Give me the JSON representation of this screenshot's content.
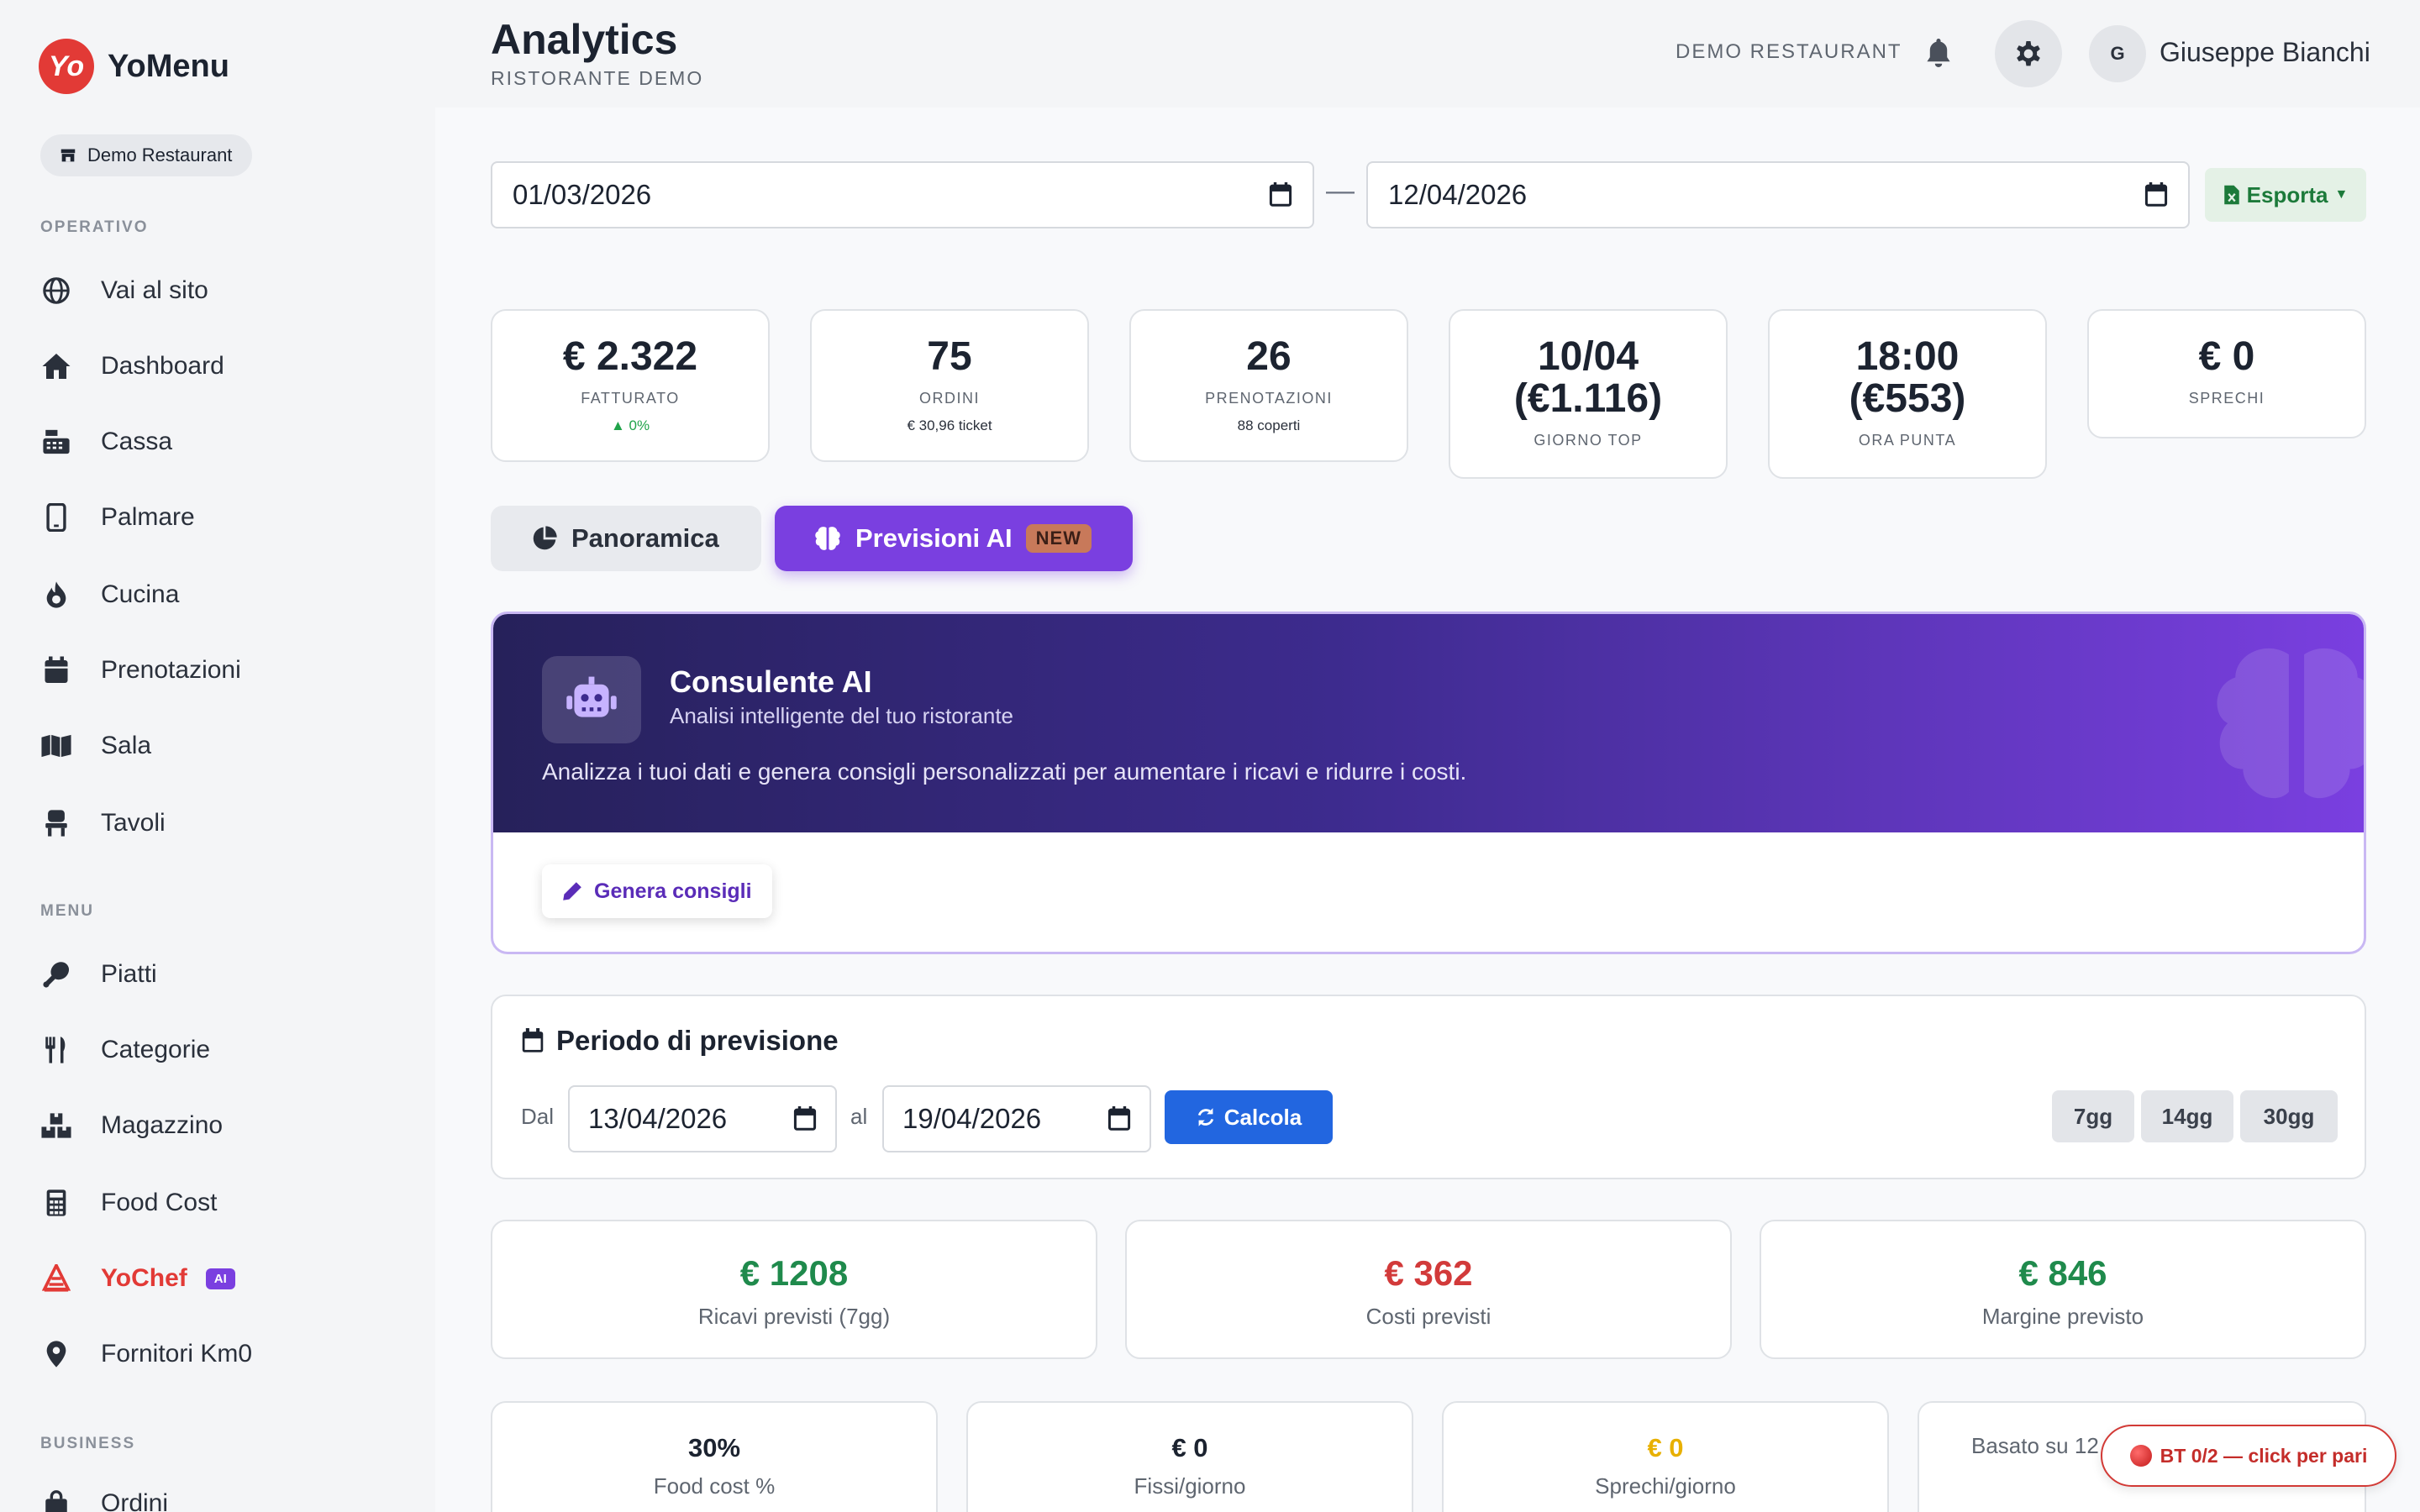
{
  "brand": {
    "logo_text": "Yo",
    "name": "YoMenu"
  },
  "restaurant_pill": "Demo Restaurant",
  "sidebar": {
    "sections": {
      "operativo": "OPERATIVO",
      "menu": "MENU",
      "business": "BUSINESS"
    },
    "items": [
      {
        "label": "Vai al sito",
        "icon": "globe-icon"
      },
      {
        "label": "Dashboard",
        "icon": "home-icon"
      },
      {
        "label": "Cassa",
        "icon": "cash-register-icon"
      },
      {
        "label": "Palmare",
        "icon": "mobile-icon"
      },
      {
        "label": "Cucina",
        "icon": "fire-icon"
      },
      {
        "label": "Prenotazioni",
        "icon": "calendar-icon"
      },
      {
        "label": "Sala",
        "icon": "map-icon"
      },
      {
        "label": "Tavoli",
        "icon": "chair-icon"
      },
      {
        "label": "Piatti",
        "icon": "drumstick-icon"
      },
      {
        "label": "Categorie",
        "icon": "utensils-icon"
      },
      {
        "label": "Magazzino",
        "icon": "boxes-icon"
      },
      {
        "label": "Food Cost",
        "icon": "calculator-icon"
      },
      {
        "label": "YoChef",
        "icon": "chef-icon",
        "badge": "AI"
      },
      {
        "label": "Fornitori Km0",
        "icon": "location-pin-icon"
      },
      {
        "label": "Ordini",
        "icon": "bag-icon"
      }
    ]
  },
  "header": {
    "title": "Analytics",
    "subtitle": "RISTORANTE DEMO",
    "restaurant": "DEMO RESTAURANT",
    "avatar_initial": "G",
    "user_name": "Giuseppe Bianchi"
  },
  "date_range": {
    "from": "01/03/2026",
    "separator": "—",
    "to": "12/04/2026"
  },
  "export_label": "Esporta",
  "kpis": [
    {
      "value": "€ 2.322",
      "label": "FATTURATO",
      "sub": "▲ 0%"
    },
    {
      "value": "75",
      "label": "ORDINI",
      "sub": "€ 30,96 ticket"
    },
    {
      "value": "26",
      "label": "PRENOTAZIONI",
      "sub": "88 coperti"
    },
    {
      "value_line1": "10/04",
      "value_line2": "(€1.116)",
      "label": "GIORNO TOP"
    },
    {
      "value_line1": "18:00",
      "value_line2": "(€553)",
      "label": "ORA PUNTA"
    },
    {
      "value": "€ 0",
      "label": "SPRECHI"
    }
  ],
  "tabs": {
    "overview": "Panoramica",
    "ai": "Previsioni AI",
    "ai_badge": "NEW"
  },
  "ai_card": {
    "title": "Consulente AI",
    "subtitle": "Analisi intelligente del tuo ristorante",
    "description": "Analizza i tuoi dati e genera consigli personalizzati per aumentare i ricavi e ridurre i costi.",
    "button": "Genera consigli"
  },
  "forecast_period": {
    "title": "Periodo di previsione",
    "from_label": "Dal",
    "from": "13/04/2026",
    "to_label": "al",
    "to": "19/04/2026",
    "calc_button": "Calcola",
    "ranges": [
      "7gg",
      "14gg",
      "30gg"
    ]
  },
  "forecast_totals": [
    {
      "value": "€ 1208",
      "label": "Ricavi previsti (7gg)",
      "color": "#1f8a4c"
    },
    {
      "value": "€ 362",
      "label": "Costi previsti",
      "color": "#d23a3a"
    },
    {
      "value": "€ 846",
      "label": "Margine previsto",
      "color": "#1f8a4c"
    }
  ],
  "small_stats": [
    {
      "value": "30%",
      "label": "Food cost %",
      "color": "#1c2330"
    },
    {
      "value": "€ 0",
      "label": "Fissi/giorno",
      "color": "#1c2330"
    },
    {
      "value": "€ 0",
      "label": "Sprechi/giorno",
      "color": "#e8b000"
    },
    {
      "text": "Basato su 12"
    }
  ],
  "bt_status": "BT 0/2 — click per pari"
}
